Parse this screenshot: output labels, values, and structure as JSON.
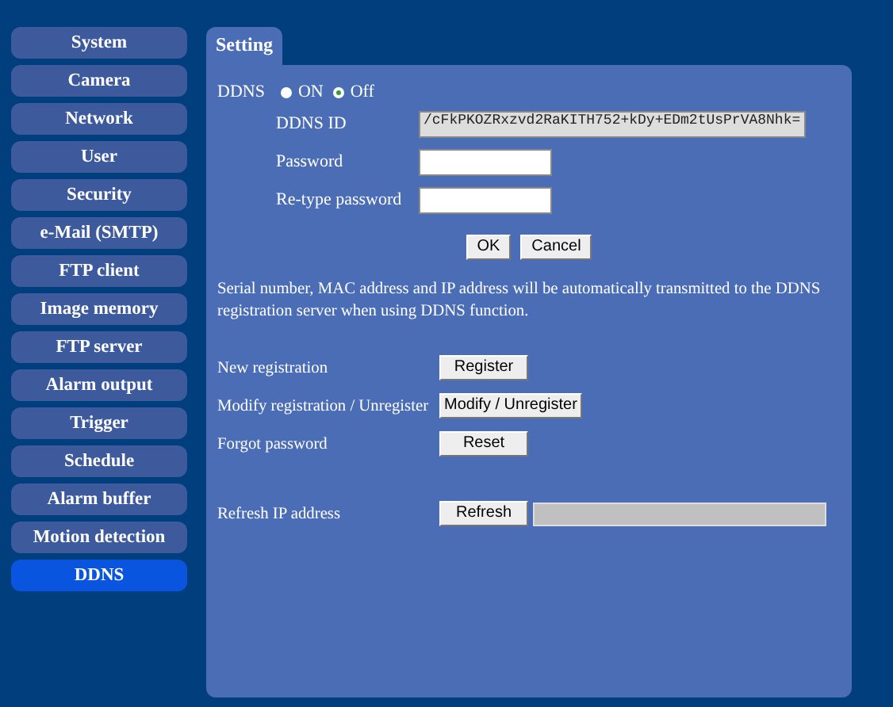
{
  "sidebar": {
    "items": [
      {
        "label": "System",
        "selected": false
      },
      {
        "label": "Camera",
        "selected": false
      },
      {
        "label": "Network",
        "selected": false
      },
      {
        "label": "User",
        "selected": false
      },
      {
        "label": "Security",
        "selected": false
      },
      {
        "label": "e-Mail (SMTP)",
        "selected": false
      },
      {
        "label": "FTP client",
        "selected": false
      },
      {
        "label": "Image memory",
        "selected": false
      },
      {
        "label": "FTP server",
        "selected": false
      },
      {
        "label": "Alarm output",
        "selected": false
      },
      {
        "label": "Trigger",
        "selected": false
      },
      {
        "label": "Schedule",
        "selected": false
      },
      {
        "label": "Alarm buffer",
        "selected": false
      },
      {
        "label": "Motion detection",
        "selected": false
      },
      {
        "label": "DDNS",
        "selected": true
      }
    ]
  },
  "tab": {
    "label": "Setting"
  },
  "ddns": {
    "label": "DDNS",
    "options": [
      {
        "label": "ON",
        "selected": false
      },
      {
        "label": "Off",
        "selected": true
      }
    ]
  },
  "fields": [
    {
      "label": "DDNS ID",
      "value": "/cFkPKOZRxzvd2RaKITH752+kDy+EDm2tUsPrVA8Nhk=",
      "kind": "id"
    },
    {
      "label": "Password",
      "kind": "password"
    },
    {
      "label": "Re-type password",
      "kind": "password"
    }
  ],
  "buttons": [
    "OK",
    "Cancel"
  ],
  "note": "Serial number, MAC address and IP address will be automatically transmitted to the DDNS registration server when using DDNS function.",
  "actions": [
    {
      "label": "New registration",
      "button": "Register"
    },
    {
      "label": "Modify registration / Unregister",
      "button": "Modify / Unregister"
    },
    {
      "label": "Forgot password",
      "button": "Reset"
    }
  ],
  "refresh": {
    "label": "Refresh IP address",
    "button": "Refresh"
  }
}
